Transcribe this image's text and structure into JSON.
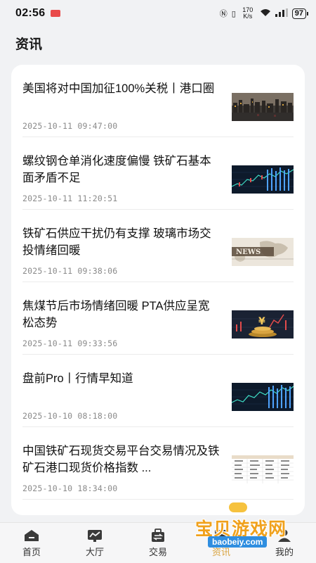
{
  "status": {
    "time": "02:56",
    "network_speed": "170 K/s",
    "signal": "6",
    "battery": "97"
  },
  "page": {
    "title": "资讯"
  },
  "news": [
    {
      "title": "美国将对中国加征100%关税丨港口圈",
      "time": "2025-10-11 09:47:00",
      "thumb": "port-skyline"
    },
    {
      "title": "螺纹钢仓单消化速度偏慢 铁矿石基本面矛盾不足",
      "time": "2025-10-11 11:20:51",
      "thumb": "market-chart"
    },
    {
      "title": "铁矿石供应干扰仍有支撑 玻璃市场交投情绪回暖",
      "time": "2025-10-11 09:38:06",
      "thumb": "news-map"
    },
    {
      "title": "焦煤节后市场情绪回暖 PTA供应呈宽松态势",
      "time": "2025-10-11 09:33:56",
      "thumb": "yen-coins"
    },
    {
      "title": "盘前Pro丨行情早知道",
      "time": "2025-10-10 08:18:00",
      "thumb": "market-chart"
    },
    {
      "title": "中国铁矿石现货交易平台交易情况及铁矿石港口现货价格指数 ...",
      "time": "2025-10-10 18:34:00",
      "thumb": "price-table"
    }
  ],
  "nav": [
    {
      "label": "首页",
      "icon": "home-icon"
    },
    {
      "label": "大厅",
      "icon": "chart-hall-icon"
    },
    {
      "label": "交易",
      "icon": "trade-icon"
    },
    {
      "label": "资讯",
      "icon": "news-icon"
    },
    {
      "label": "我的",
      "icon": "profile-icon"
    }
  ],
  "watermark": {
    "text": "宝贝游戏网",
    "url": "baobeiy.com"
  }
}
